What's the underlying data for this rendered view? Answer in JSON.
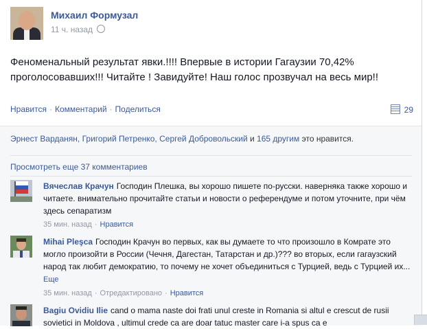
{
  "post": {
    "author": "Михаил Формузал",
    "time": "11 ч. назад",
    "text": "Феноменальный результат явки.!!!! Впервые в истории Гагаузии 70,42% проголосовавших!!! Читайте ! Завидуйте! Наш голос прозвучал на весь мир!!",
    "actions": {
      "like": "Нравится",
      "comment": "Комментарий",
      "share": "Поделиться",
      "separator": "·"
    },
    "comment_count": "29",
    "likes": {
      "names": "Эрнест Варданян, Григорий Петренко, Сергей Добровольский",
      "and": " и ",
      "others": "165 другим",
      "suffix": " это нравится."
    },
    "view_more": "Просмотреть еще 37 комментариев"
  },
  "comments": [
    {
      "name": "Вячеслав Крачун",
      "text": "Господин Плешка, вы хорошо пишете по-русски. наверняка также хорошо и читаете. внимательно прочитайте статьи и новости о референдуме и потом уточните, при чём здесь сепаратизм",
      "time": "35 мин. назад",
      "like": "Нравится",
      "sep": "·"
    },
    {
      "name": "Mihai Pleşca",
      "text": "Господин Крачун во первых, как вы думаете то что произошло в Комрате это могло произойти в России (Чечня, Дагестан, Татарстан и др.)??? во вторых, если гагаузский народ так любит демократию, то почему не хочет объединиться с Турцией, ведь с Турцией их...",
      "more": "Еще",
      "time": "35 мин. назад",
      "edited": "Отредактировано",
      "like": "Нравится",
      "sep": "·"
    },
    {
      "name": "Bagiu Ovidiu Ilie",
      "text": "cand o mama naste doi frati unul creste in Romania si altul e crescut de rusii sovietici in Moldova , ultimul crede ca are doar tatuc master care i-a spus ca e"
    }
  ]
}
